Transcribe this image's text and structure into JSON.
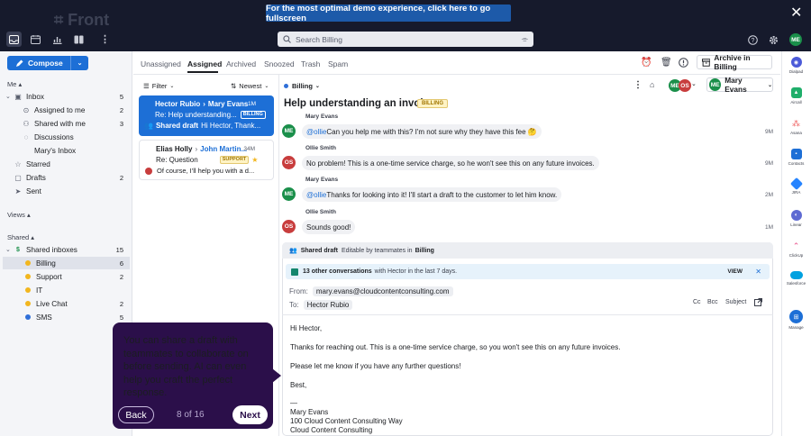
{
  "banner": {
    "text": "For the most optimal demo experience, click here to go fullscreen"
  },
  "topbar": {
    "search_placeholder": "Search Billing",
    "avatar": "ME"
  },
  "sidebar": {
    "compose_label": "Compose",
    "me_section": "Me",
    "items": [
      {
        "label": "Inbox",
        "count": "5",
        "icon": "inbox-icon"
      },
      {
        "label": "Assigned to me",
        "count": "2",
        "icon": "assigned-icon"
      },
      {
        "label": "Shared with me",
        "count": "3",
        "icon": "shared-icon"
      },
      {
        "label": "Discussions",
        "count": "",
        "icon": "discussions-icon"
      },
      {
        "label": "Mary's Inbox",
        "count": "",
        "icon": "inbox-icon"
      },
      {
        "label": "Starred",
        "count": "",
        "icon": "star-icon"
      },
      {
        "label": "Drafts",
        "count": "2",
        "icon": "drafts-icon"
      },
      {
        "label": "Sent",
        "count": "",
        "icon": "sent-icon"
      }
    ],
    "views_section": "Views",
    "shared_section": "Shared",
    "shared_inboxes": {
      "label": "Shared inboxes",
      "count": "15"
    },
    "inboxes": [
      {
        "label": "Billing",
        "count": "6",
        "color": "#f2b61e"
      },
      {
        "label": "Support",
        "count": "2",
        "color": "#f2b61e"
      },
      {
        "label": "IT",
        "count": "",
        "color": "#f2b61e"
      },
      {
        "label": "Live Chat",
        "count": "2",
        "color": "#f2b61e"
      },
      {
        "label": "SMS",
        "count": "5",
        "color": "#2f6fd8"
      }
    ]
  },
  "tabs": [
    "Unassigned",
    "Assigned",
    "Archived",
    "Snoozed",
    "Trash",
    "Spam"
  ],
  "list": {
    "filter": "Filter",
    "sort": "Newest",
    "inbox": "Billing",
    "cards": [
      {
        "from": "Hector Rubio",
        "to": "Mary Evans",
        "time": "1M",
        "subject": "Re: Help understanding...",
        "tag": "BILLING",
        "preview_label": "Shared draft",
        "preview": "Hi Hector, Thank..."
      },
      {
        "from": "Elias Holly",
        "to": "John Martin...",
        "time": "34M",
        "subject": "Re: Question",
        "tag": "SUPPORT",
        "preview": "Of course, I'll help you with a d..."
      }
    ]
  },
  "header_actions": {
    "archive": "Archive in Billing",
    "assignee": "Mary Evans",
    "avatar_me": "ME",
    "avatar_os": "OS"
  },
  "conversation": {
    "title": "Help understanding an invoice",
    "tag": "BILLING",
    "messages": [
      {
        "author": "Mary Evans",
        "avatar": "ME",
        "mention": "@ollie",
        "text": " Can you help me with this? I'm not sure why they have this fee 🤔",
        "time": "9M"
      },
      {
        "author": "Ollie Smith",
        "avatar": "OS",
        "mention": "",
        "text": "No problem! This is a one-time service charge, so he won't see this on any future invoices.",
        "time": "9M"
      },
      {
        "author": "Mary Evans",
        "avatar": "ME",
        "mention": "@ollie",
        "text": " Thanks for looking into it! I'll start a draft to the customer to let him know.",
        "time": "2M"
      },
      {
        "author": "Ollie Smith",
        "avatar": "OS",
        "mention": "",
        "text": "Sounds good!",
        "time": "1M"
      }
    ]
  },
  "draft": {
    "header_bold": "Shared draft",
    "header_text": "Editable by teammates in",
    "header_inbox": "Billing",
    "other_bold": "13 other conversations",
    "other_text": "with Hector in the last 7 days.",
    "view": "VIEW",
    "from_label": "From:",
    "from_value": "mary.evans@cloudcontentconsulting.com",
    "to_label": "To:",
    "to_value": "Hector Rubio",
    "cc": "Cc",
    "bcc": "Bcc",
    "subject": "Subject",
    "body": [
      "Hi Hector,",
      "Thanks for reaching out. This is a one-time service charge, so you won't see this on any future invoices.",
      "Please let me know if you have any further questions!",
      "Best,",
      "—",
      "Mary Evans",
      "100 Cloud Content Consulting Way",
      "Cloud Content Consulting"
    ]
  },
  "integrations": [
    {
      "label": "Dialpad",
      "color": "#4b5ad8"
    },
    {
      "label": "Aircall",
      "color": "#1fae6a"
    },
    {
      "label": "Asana",
      "color": "#f06a6a"
    },
    {
      "label": "Contacts",
      "color": "#1d6fd6"
    },
    {
      "label": "JIRA",
      "color": "#2684ff"
    },
    {
      "label": "Linear",
      "color": "#5e6ad2"
    },
    {
      "label": "ClickUp",
      "color": "#e94c89"
    },
    {
      "label": "Salesforce",
      "color": "#00a1e0"
    },
    {
      "label": "Manage",
      "color": "#1d6fd6"
    }
  ],
  "tour": {
    "text": "You can share a draft with teammates to collaborate on before sending. AI can even help you craft the perfect response.",
    "back": "Back",
    "count": "8 of 16",
    "next": "Next"
  }
}
